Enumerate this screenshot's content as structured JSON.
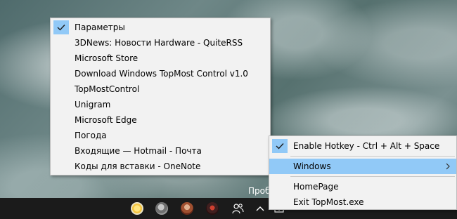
{
  "window_menu": {
    "items": [
      {
        "label": "Параметры",
        "checked": true
      },
      {
        "label": "3DNews: Новости Hardware - QuiteRSS",
        "checked": false
      },
      {
        "label": "Microsoft Store",
        "checked": false
      },
      {
        "label": "Download Windows TopMost Control v1.0",
        "checked": false
      },
      {
        "label": "TopMostControl",
        "checked": false
      },
      {
        "label": "Unigram",
        "checked": false
      },
      {
        "label": "Microsoft Edge",
        "checked": false
      },
      {
        "label": "Погода",
        "checked": false
      },
      {
        "label": "Входящие — Hotmail - Почта",
        "checked": false
      },
      {
        "label": "Коды для вставки - OneNote",
        "checked": false
      }
    ]
  },
  "tray_menu": {
    "enable_hotkey": "Enable Hotkey - Ctrl + Alt + Space",
    "enable_hotkey_checked": true,
    "windows": "Windows",
    "homepage": "HomePage",
    "exit": "Exit TopMost.exe"
  },
  "peek_text": "Проб",
  "colors": {
    "highlight": "#91c9f7",
    "menu_bg": "#f2f2f2",
    "taskbar_bg": "#1b1b1b"
  },
  "taskbar": {
    "icons": [
      "weather-sun-icon",
      "avatar-icon",
      "avatar-icon",
      "avatar-icon",
      "people-icon",
      "chevron-up-icon",
      "topmost-tray-icon"
    ]
  }
}
